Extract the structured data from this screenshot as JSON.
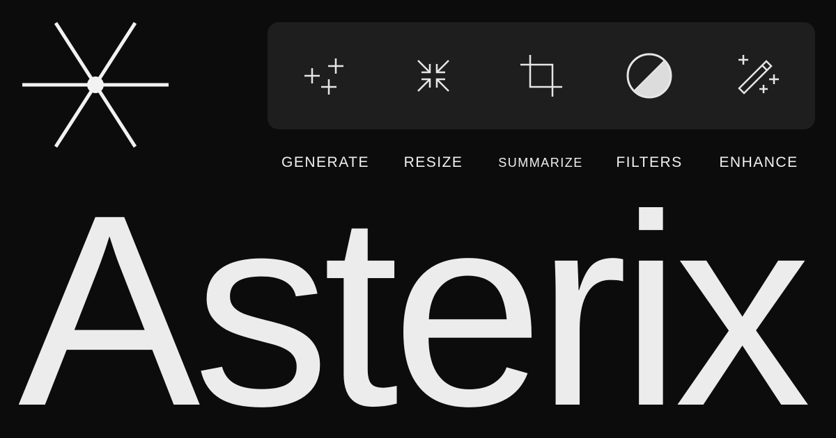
{
  "brand": {
    "logo_icon": "asterisk-logo-icon",
    "wordmark": "Asterix"
  },
  "toolbar": {
    "tools": [
      {
        "label": "GENERATE",
        "icon": "sparkle-plus-icon"
      },
      {
        "label": "RESIZE",
        "icon": "compress-arrows-icon"
      },
      {
        "label": "SUMMARIZE",
        "icon": "crop-icon"
      },
      {
        "label": "FILTERS",
        "icon": "contrast-circle-icon"
      },
      {
        "label": "ENHANCE",
        "icon": "magic-wand-icon"
      }
    ]
  },
  "colors": {
    "background": "#0c0c0c",
    "toolbar": "#1e1e1e",
    "foreground": "#ececec"
  }
}
